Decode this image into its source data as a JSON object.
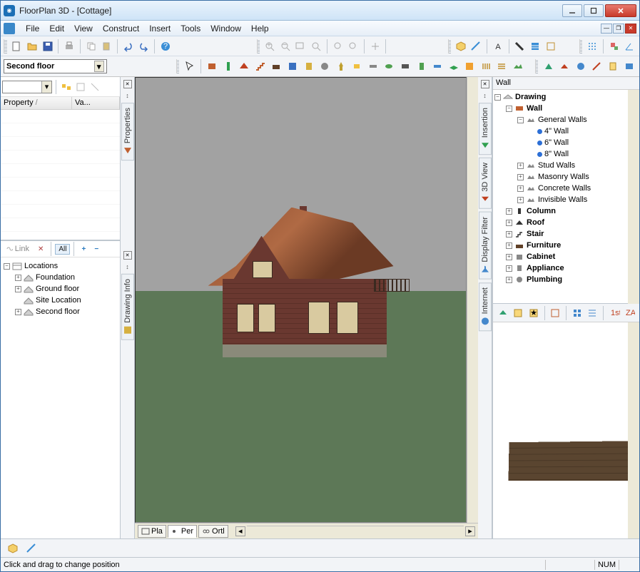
{
  "title": "FloorPlan 3D - [Cottage]",
  "menu": [
    "File",
    "Edit",
    "View",
    "Construct",
    "Insert",
    "Tools",
    "Window",
    "Help"
  ],
  "floor_selector": "Second floor",
  "property_panel": {
    "headers": [
      "Property",
      "Va..."
    ],
    "sort_indicator": "/"
  },
  "locations_toolbar": {
    "link": "Link",
    "all": "All"
  },
  "locations_tree": {
    "root": "Locations",
    "children": [
      "Foundation",
      "Ground floor",
      "Site Location",
      "Second floor"
    ],
    "expandable": {
      "Foundation": true,
      "Ground floor": true,
      "Site Location": false,
      "Second floor": true
    }
  },
  "left_vtabs": [
    "Properties",
    "Drawing Info"
  ],
  "center_vtabs": [
    "Insertion",
    "3D View",
    "Display Filter",
    "Internet"
  ],
  "viewport_tabs": [
    "Pla",
    "Per",
    "Ortl"
  ],
  "right_panel": {
    "title": "Wall",
    "tree": {
      "root": "Drawing",
      "wall": "Wall",
      "general": "General Walls",
      "walls": [
        "4\" Wall",
        "6\" Wall",
        "8\" Wall"
      ],
      "groups": [
        "Stud Walls",
        "Masonry Walls",
        "Concrete Walls",
        "Invisible Walls"
      ],
      "siblings": [
        "Column",
        "Roof",
        "Stair",
        "Furniture",
        "Cabinet",
        "Appliance",
        "Plumbing"
      ]
    }
  },
  "status": {
    "hint": "Click and drag to change position",
    "num": "NUM"
  }
}
